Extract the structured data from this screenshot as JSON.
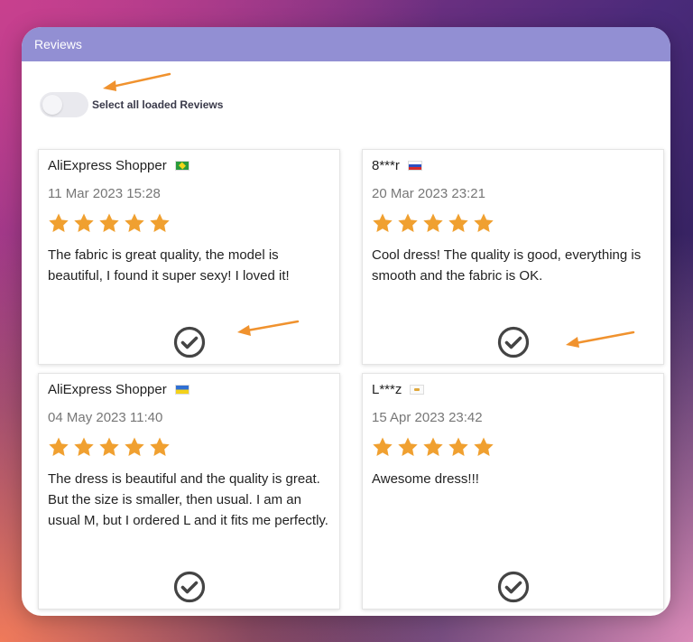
{
  "panel": {
    "title": "Reviews"
  },
  "select_all": {
    "label": "Select all loaded Reviews"
  },
  "reviews": [
    {
      "author": "AliExpress Shopper",
      "flag": "brazil-flag-icon",
      "date": "11 Mar 2023 15:28",
      "rating": 5,
      "text": "The fabric is great quality, the model is beautiful, I found it super sexy! I loved it!"
    },
    {
      "author": "8***r",
      "flag": "russia-flag-icon",
      "date": "20 Mar 2023 23:21",
      "rating": 5,
      "text": "Cool dress! The quality is good, everything is smooth and the fabric is OK."
    },
    {
      "author": "AliExpress Shopper",
      "flag": "ukraine-flag-icon",
      "date": "04 May 2023 11:40",
      "rating": 5,
      "text": "The dress is beautiful and the quality is great. But the size is smaller, then usual. I am an usual M, but I ordered L and it fits me perfectly."
    },
    {
      "author": "L***z",
      "flag": "cyprus-flag-icon",
      "date": "15 Apr 2023 23:42",
      "rating": 5,
      "text": "Awesome dress!!!"
    }
  ],
  "colors": {
    "header": "#928fd3",
    "star": "#f0a030",
    "arrow": "#f0922e",
    "check": "#444444"
  }
}
